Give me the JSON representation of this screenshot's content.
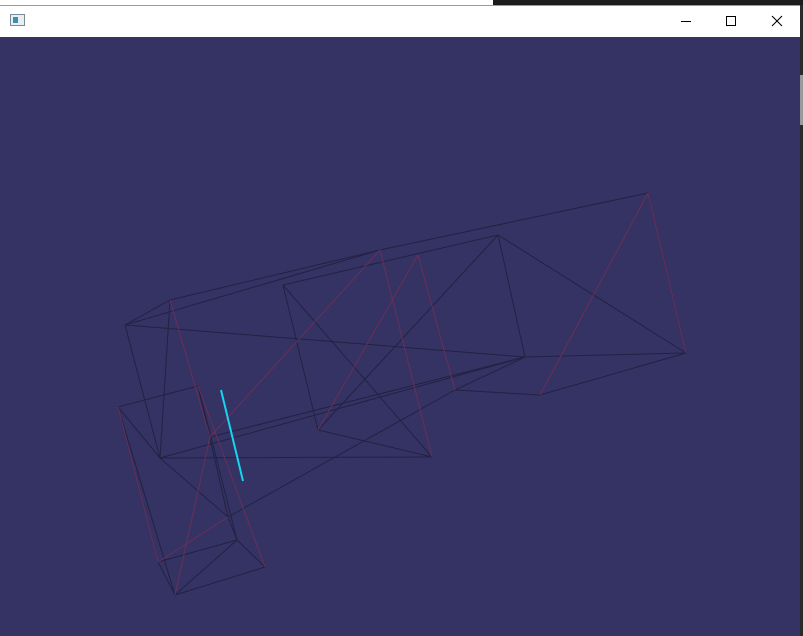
{
  "window": {
    "title": "",
    "background_color": "#343363",
    "icons": {
      "app": "app-window-icon",
      "minimize": "minimize-icon",
      "maximize": "maximize-icon",
      "close": "close-icon"
    }
  },
  "scene": {
    "description_type": "wireframe-3d-render",
    "edge_colors": {
      "dark": "#222244",
      "red": "#6a2f58",
      "highlight": "#17d4f0"
    }
  }
}
